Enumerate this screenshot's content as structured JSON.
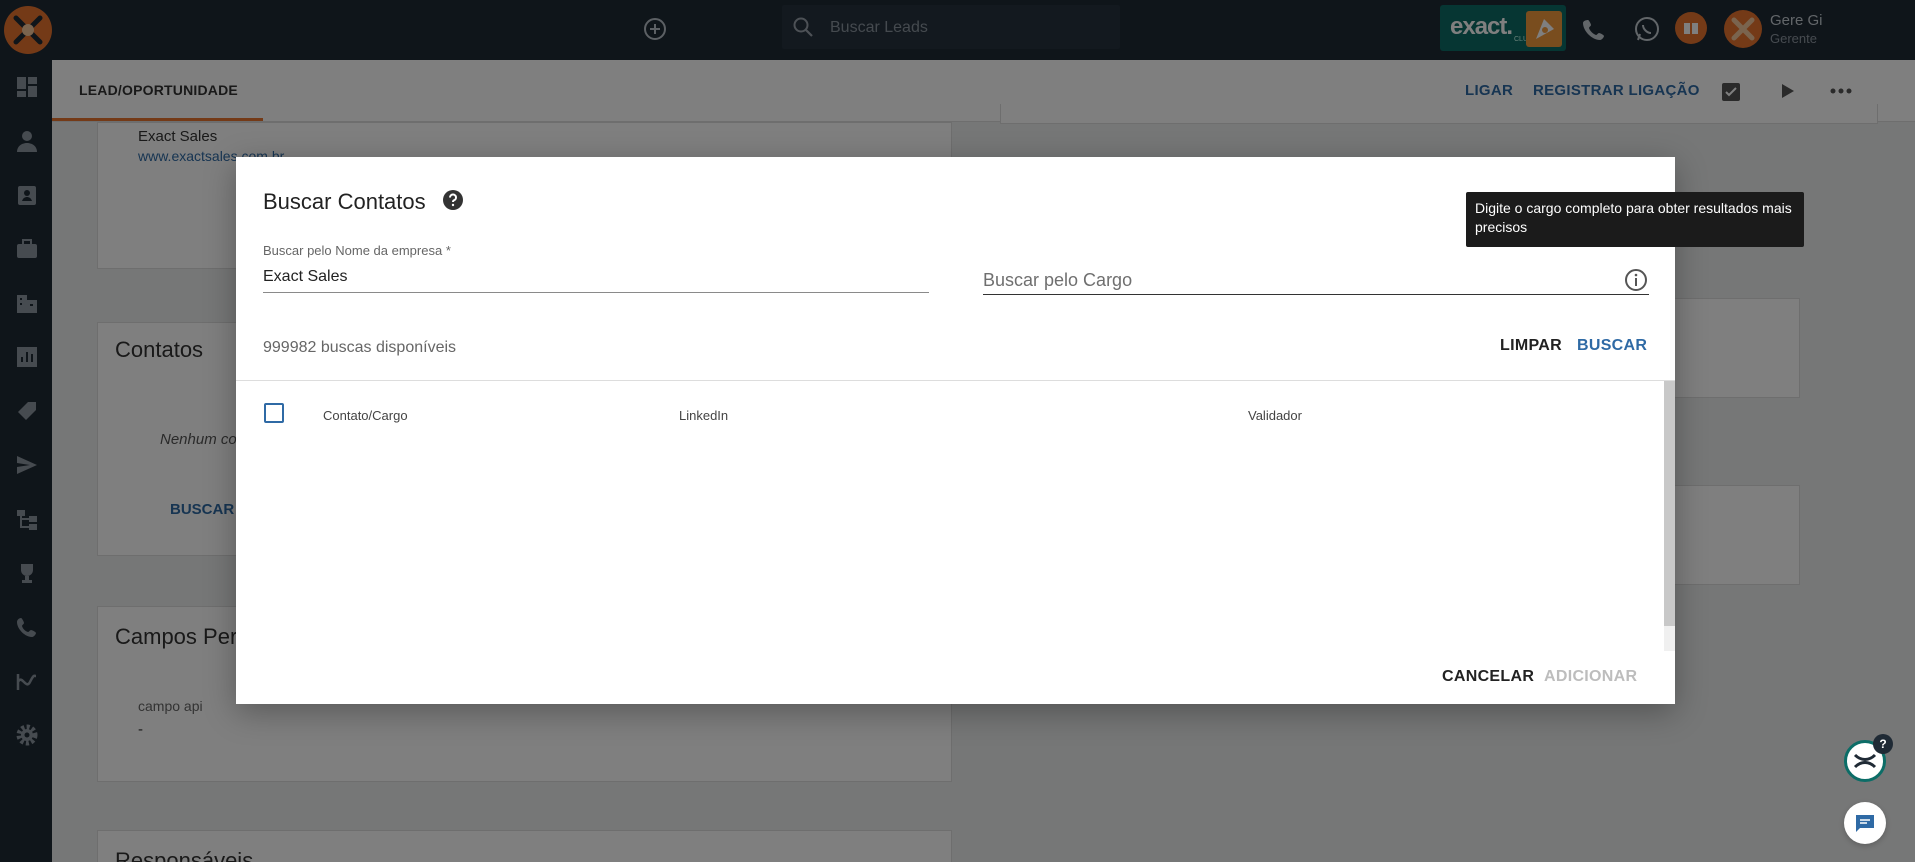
{
  "topbar": {
    "search_placeholder": "Buscar Leads",
    "exact_badge": "exact.",
    "exact_badge_sub": "CLUB",
    "user_name": "Gere Gi",
    "user_role": "Gerente"
  },
  "sidebar": {
    "icons": [
      "dashboard-icon",
      "person-icon",
      "contact-card-icon",
      "briefcase-icon",
      "building-icon",
      "chart-icon",
      "tag-icon",
      "send-icon",
      "workflow-icon",
      "trophy-icon",
      "phone-icon",
      "reports-icon",
      "gear-icon"
    ]
  },
  "subheader": {
    "tab_label": "LEAD/OPORTUNIDADE",
    "ligar": "LIGAR",
    "registrar": "REGISTRAR LIGAÇÃO"
  },
  "background": {
    "company_name": "Exact Sales",
    "company_site": "www.exactsales.com.br",
    "contatos_title": "Contatos",
    "nenhum_text": "Nenhum co",
    "buscar_partial": "BUSCAR",
    "campos_title": "Campos Per",
    "campo_label": "campo api",
    "campo_value": "-",
    "responsaveis_title": "Responsáveis"
  },
  "modal": {
    "title": "Buscar Contatos",
    "company_field_label": "Buscar pelo Nome da empresa *",
    "company_field_value": "Exact Sales",
    "cargo_placeholder": "Buscar pelo Cargo",
    "available_searches": "999982 buscas disponíveis",
    "limpar": "LIMPAR",
    "buscar": "BUSCAR",
    "columns": [
      "Contato/Cargo",
      "LinkedIn",
      "Validador"
    ],
    "cancelar": "CANCELAR",
    "adicionar": "ADICIONAR"
  },
  "tooltip": {
    "text": "Digite o cargo completo para obter resultados mais precisos"
  },
  "fab": {
    "help_badge": "?"
  },
  "colors": {
    "dark": "#1f2a35",
    "accent_orange": "#e8742e",
    "link_blue": "#2f6aa5",
    "teal": "#0c6d67"
  }
}
